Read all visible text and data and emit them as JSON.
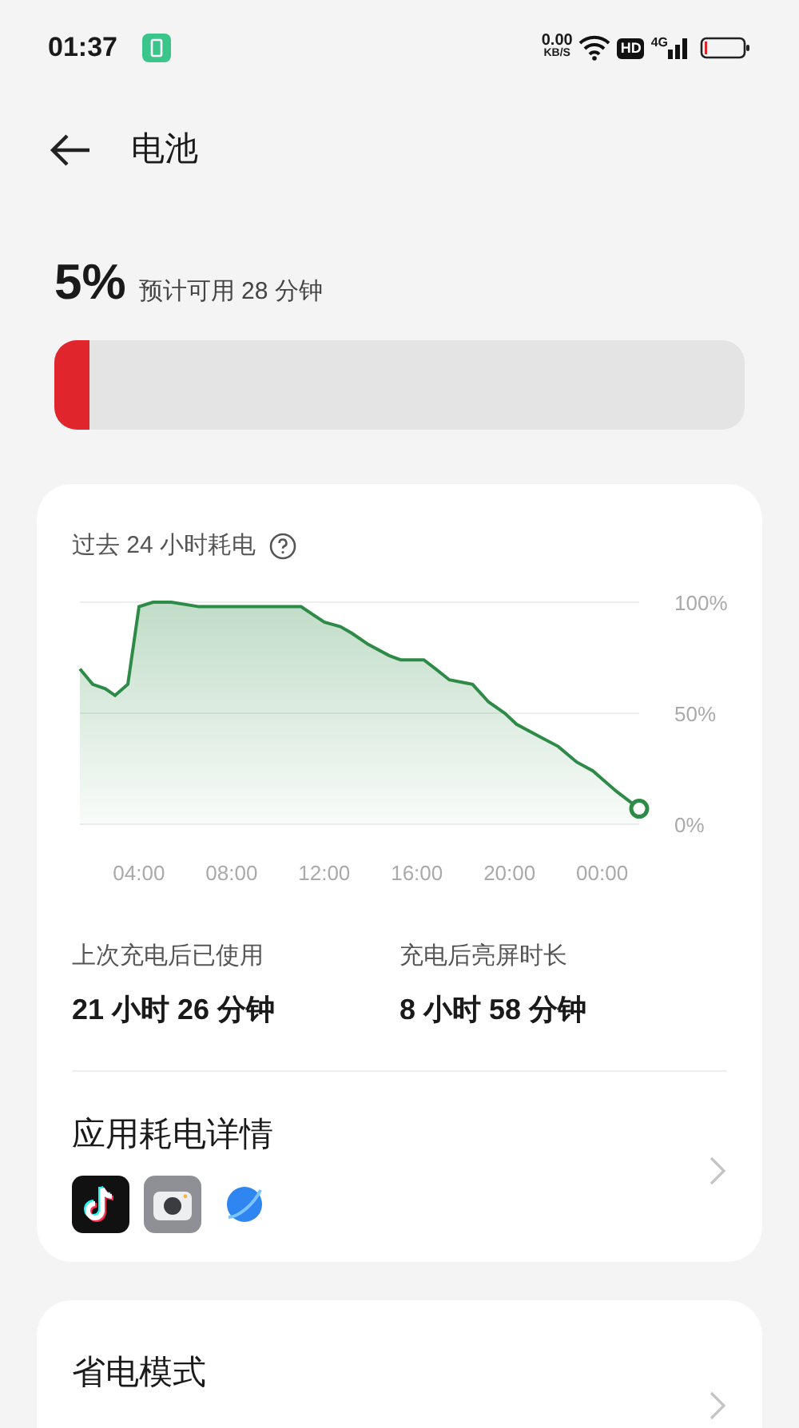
{
  "status_bar": {
    "time": "01:37",
    "net_speed": "0.00",
    "net_unit": "KB/S",
    "hd": "HD",
    "network": "4G"
  },
  "header": {
    "title": "电池"
  },
  "battery": {
    "percent": "5%",
    "estimate": "预计可用 28 分钟",
    "level": 0.05
  },
  "usage_card": {
    "title": "过去 24 小时耗电",
    "chart_data": {
      "type": "area",
      "x": [
        1.45,
        2.0,
        2.55,
        2.97,
        3.52,
        4.0,
        4.6,
        5.4,
        6.6,
        8.5,
        9.4,
        11.0,
        12.0,
        12.7,
        13.2,
        13.9,
        14.8,
        15.3,
        16.3,
        16.8,
        17.4,
        17.9,
        18.4,
        19.1,
        19.8,
        20.3,
        21.2,
        22.1,
        22.9,
        23.6,
        24.6,
        25.6
      ],
      "series": [
        {
          "color": "#2e8b47",
          "values": [
            70,
            63,
            61,
            58,
            63,
            98,
            100,
            100,
            98,
            98,
            98,
            98,
            91,
            89,
            86,
            81,
            76,
            74,
            74,
            70,
            65,
            64,
            63,
            55,
            50,
            45,
            40,
            35,
            28,
            24,
            15,
            7
          ]
        }
      ],
      "xlim": [
        1.45,
        25.6
      ],
      "ylim": [
        0,
        100
      ],
      "xticks": [
        {
          "value": 4,
          "label": "04:00"
        },
        {
          "value": 8,
          "label": "08:00"
        },
        {
          "value": 12,
          "label": "12:00"
        },
        {
          "value": 16,
          "label": "16:00"
        },
        {
          "value": 20,
          "label": "20:00"
        },
        {
          "value": 24,
          "label": "00:00"
        }
      ],
      "yticks": [
        {
          "value": 0,
          "label": "0%"
        },
        {
          "value": 50,
          "label": "50%"
        },
        {
          "value": 100,
          "label": "100%"
        }
      ]
    },
    "stats": [
      {
        "label": "上次充电后已使用",
        "value": "21 小时 26 分钟"
      },
      {
        "label": "充电后亮屏时长",
        "value": "8 小时 58 分钟"
      }
    ],
    "app_details": {
      "title": "应用耗电详情",
      "apps": [
        {
          "kind": "music"
        },
        {
          "kind": "camera"
        },
        {
          "kind": "planet"
        }
      ]
    }
  },
  "power_saving": {
    "title": "省电模式"
  }
}
